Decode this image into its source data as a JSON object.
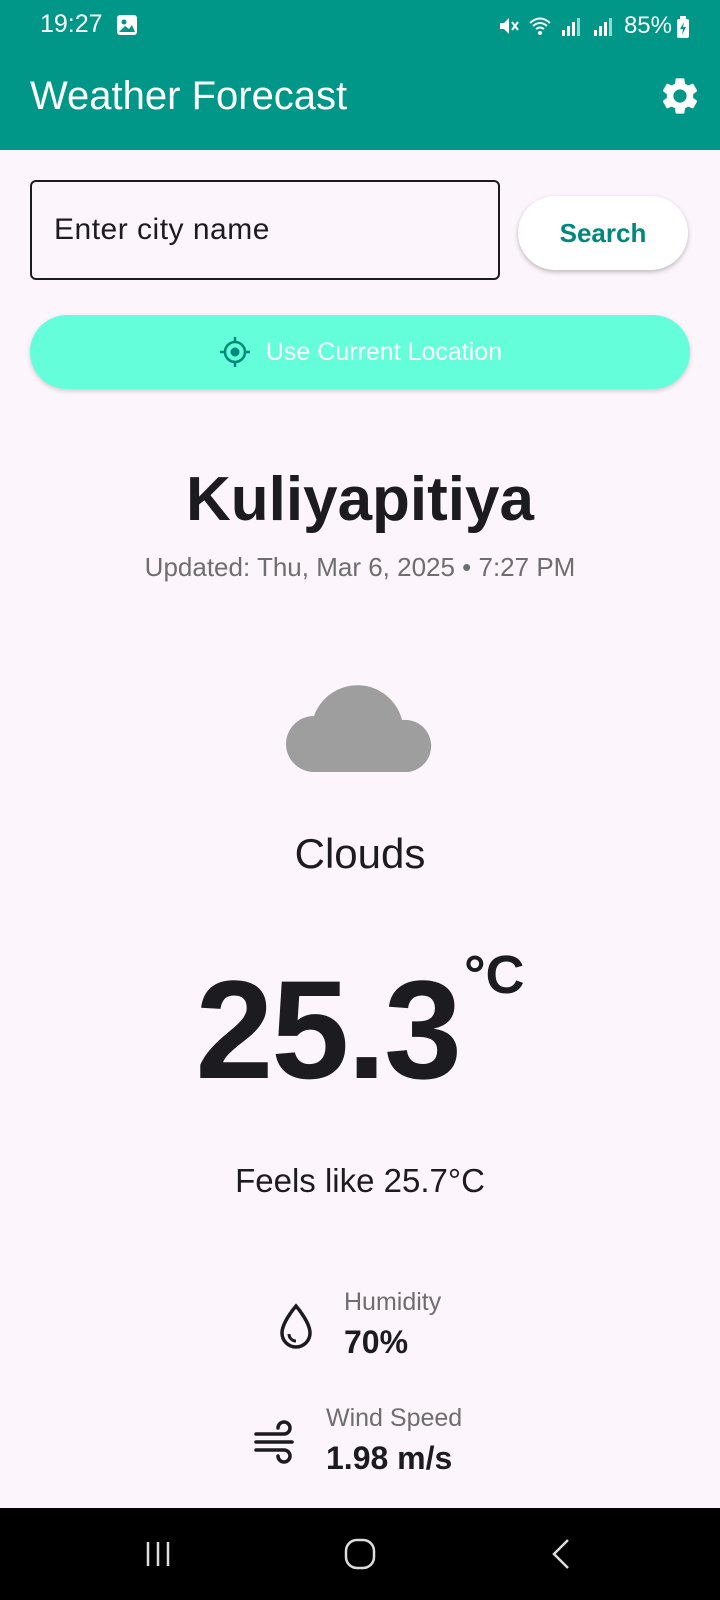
{
  "status_bar": {
    "time": "19:27",
    "battery": "85%",
    "icons": [
      "gallery-icon",
      "mute-icon",
      "wifi-icon",
      "lte1-signal-icon",
      "lte2-signal-icon",
      "battery-charging-icon"
    ]
  },
  "app_bar": {
    "title": "Weather Forecast",
    "settings_icon": "gear-icon",
    "color": "#009688"
  },
  "search": {
    "placeholder": "Enter city name",
    "button_label": "Search"
  },
  "location_button": {
    "label": "Use Current Location",
    "icon": "gps-icon",
    "color": "#64ffda"
  },
  "weather": {
    "city": "Kuliyapitiya",
    "updated": "Updated: Thu, Mar 6, 2025 • 7:27 PM",
    "condition_icon": "cloud-icon",
    "condition": "Clouds",
    "temperature": "25.3",
    "unit": "°C",
    "feels_like": "Feels like 25.7°C"
  },
  "details": {
    "humidity": {
      "icon": "water-drop-icon",
      "label": "Humidity",
      "value": "70%"
    },
    "wind": {
      "icon": "wind-icon",
      "label": "Wind Speed",
      "value": "1.98 m/s"
    }
  },
  "nav_bar": {
    "icons": [
      "recent-apps-icon",
      "home-icon",
      "back-icon"
    ]
  }
}
